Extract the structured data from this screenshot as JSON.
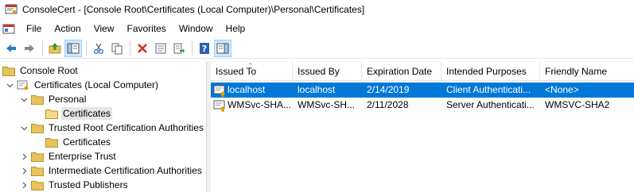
{
  "window": {
    "title": "ConsoleCert - [Console Root\\Certificates (Local Computer)\\Personal\\Certificates]"
  },
  "menu": [
    "File",
    "Action",
    "View",
    "Favorites",
    "Window",
    "Help"
  ],
  "toolbar": {
    "buttons": [
      "back-arrow",
      "forward-arrow",
      "up-folder",
      "show-hide-tree",
      "cut",
      "copy",
      "delete",
      "properties",
      "export-list",
      "help",
      "show-hide-action-pane"
    ]
  },
  "tree": [
    {
      "label": "Console Root",
      "level": 0,
      "expanded": null
    },
    {
      "label": "Certificates (Local Computer)",
      "level": 1,
      "expanded": true
    },
    {
      "label": "Personal",
      "level": 2,
      "expanded": true
    },
    {
      "label": "Certificates",
      "level": 3,
      "expanded": null,
      "selected": true
    },
    {
      "label": "Trusted Root Certification Authorities",
      "level": 2,
      "expanded": true
    },
    {
      "label": "Certificates",
      "level": 3,
      "expanded": null
    },
    {
      "label": "Enterprise Trust",
      "level": 2,
      "expanded": false
    },
    {
      "label": "Intermediate Certification Authorities",
      "level": 2,
      "expanded": false
    },
    {
      "label": "Trusted Publishers",
      "level": 2,
      "expanded": false
    }
  ],
  "list": {
    "columns": [
      "Issued To",
      "Issued By",
      "Expiration Date",
      "Intended Purposes",
      "Friendly Name"
    ],
    "sorted_column": "Issued To",
    "rows": [
      {
        "issued_to": "localhost",
        "issued_by": "localhost",
        "expiration": "2/14/2019",
        "purposes": "Client Authenticati...",
        "friendly_name": "<None>",
        "selected": true
      },
      {
        "issued_to": "WMSvc-SHA...",
        "issued_by": "WMSvc-SH...",
        "expiration": "2/11/2028",
        "purposes": "Server Authenticati...",
        "friendly_name": "WMSVC-SHA2",
        "selected": false
      }
    ]
  },
  "colors": {
    "selection": "#0078d7",
    "tree_selection": "#e5e5e5",
    "folder": "#e8c35a"
  }
}
